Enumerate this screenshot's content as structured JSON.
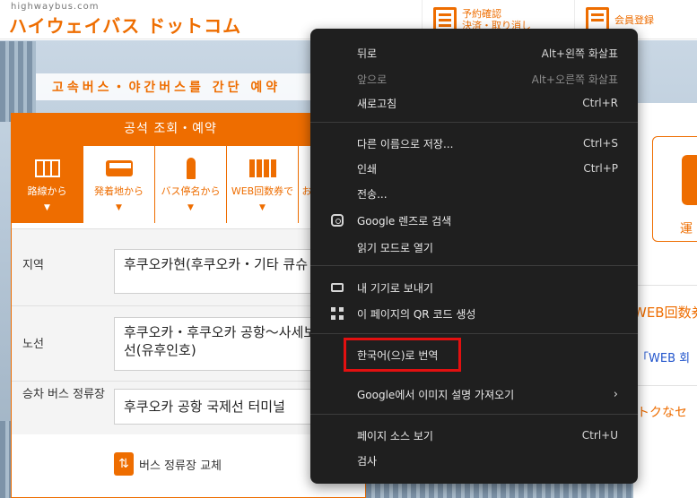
{
  "header": {
    "logo_url": "highwaybus.com",
    "logo_main": "ハイウェイバス ドットコム",
    "reserve_link_line1": "予約確認",
    "reserve_link_line2": "決済・取り消し",
    "member_link": "会員登録"
  },
  "banner": {
    "text": "고속버스・야간버스를 간단 예약"
  },
  "panel": {
    "title": "공석 조회・예약",
    "tabs": [
      {
        "label": "路線から",
        "icon": "map-icon"
      },
      {
        "label": "発着地から",
        "icon": "bus-icon"
      },
      {
        "label": "バス停名から",
        "icon": "bus-stop-icon"
      },
      {
        "label": "WEB回数券で",
        "icon": "ticket-icon"
      },
      {
        "label": "お"
      }
    ],
    "region_label": "지역",
    "region_value": "후쿠오카현(후쿠오카・기타 큐슈 등)",
    "route_label": "노선",
    "route_value": "후쿠오카・후쿠오카 공항～사세보 후인선(유후인호)",
    "stop_label": "승차 버스 정류장",
    "stop_value": "후쿠오카 공항 국제선 터미널",
    "swap_label": "버스 정류장 교체"
  },
  "right": {
    "card_text": "運",
    "web_title": "WEB回数券",
    "web_link": "「WEB 회",
    "notice": "トクなセ"
  },
  "context_menu": {
    "items": [
      {
        "label": "뒤로",
        "shortcut": "Alt+왼쪽 화살표"
      },
      {
        "label": "앞으로",
        "shortcut": "Alt+오른쪽 화살표",
        "disabled": true
      },
      {
        "label": "새로고침",
        "shortcut": "Ctrl+R"
      },
      {
        "label": "다른 이름으로 저장...",
        "shortcut": "Ctrl+S"
      },
      {
        "label": "인쇄",
        "shortcut": "Ctrl+P"
      },
      {
        "label": "전송..."
      },
      {
        "label": "Google 렌즈로 검색",
        "icon": "google-lens-icon"
      },
      {
        "label": "읽기 모드로 열기"
      },
      {
        "label": "내 기기로 보내기",
        "icon": "device-icon"
      },
      {
        "label": "이 페이지의 QR 코드 생성",
        "icon": "qr-code-icon"
      },
      {
        "label": "한국어(으)로 번역"
      },
      {
        "label": "Google에서 이미지 설명 가져오기",
        "submenu": "›"
      },
      {
        "label": "페이지 소스 보기",
        "shortcut": "Ctrl+U"
      },
      {
        "label": "검사"
      }
    ]
  },
  "colors": {
    "brand_orange": "#ee6d00",
    "menu_bg": "#1f1f1f",
    "highlight_red": "#e21010"
  }
}
